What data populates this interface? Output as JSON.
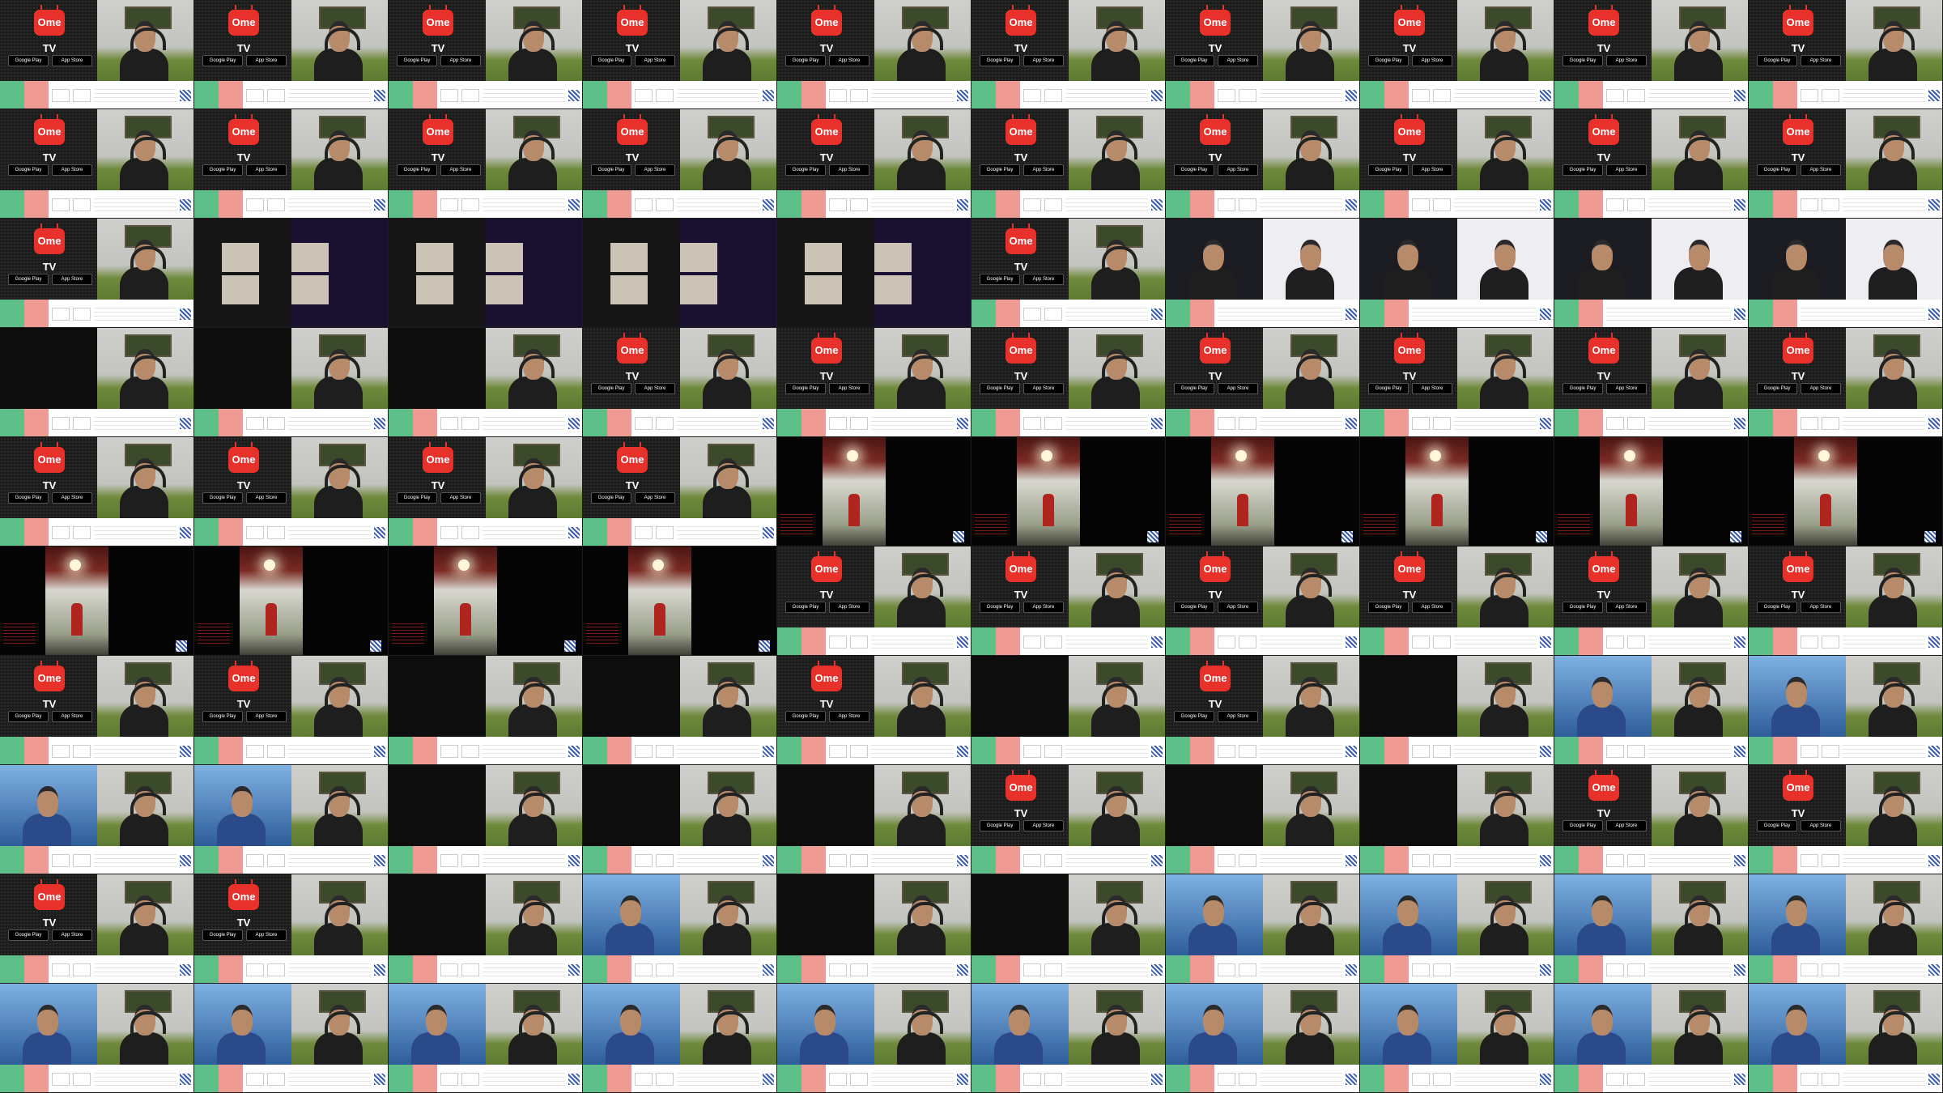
{
  "sheet": {
    "title": "",
    "cells": [
      {
        "layout": "ome"
      },
      {
        "layout": "ome"
      },
      {
        "layout": "ome"
      },
      {
        "layout": "ome"
      },
      {
        "layout": "ome"
      },
      {
        "layout": "ome"
      },
      {
        "layout": "ome"
      },
      {
        "layout": "ome"
      },
      {
        "layout": "ome"
      },
      {
        "layout": "ome"
      },
      {
        "layout": "ome"
      },
      {
        "layout": "ome"
      },
      {
        "layout": "ome"
      },
      {
        "layout": "ome"
      },
      {
        "layout": "ome"
      },
      {
        "layout": "ome"
      },
      {
        "layout": "ome"
      },
      {
        "layout": "ome"
      },
      {
        "layout": "ome"
      },
      {
        "layout": "ome"
      },
      {
        "layout": "ome"
      },
      {
        "layout": "purple"
      },
      {
        "layout": "purple"
      },
      {
        "layout": "purple"
      },
      {
        "layout": "purple"
      },
      {
        "layout": "ome"
      },
      {
        "layout": "stream"
      },
      {
        "layout": "stream"
      },
      {
        "layout": "stream"
      },
      {
        "layout": "stream"
      },
      {
        "layout": "dim"
      },
      {
        "layout": "dim"
      },
      {
        "layout": "dim"
      },
      {
        "layout": "ome"
      },
      {
        "layout": "ome"
      },
      {
        "layout": "ome"
      },
      {
        "layout": "ome"
      },
      {
        "layout": "ome"
      },
      {
        "layout": "ome"
      },
      {
        "layout": "ome"
      },
      {
        "layout": "ome"
      },
      {
        "layout": "ome"
      },
      {
        "layout": "ome"
      },
      {
        "layout": "ome"
      },
      {
        "layout": "dark"
      },
      {
        "layout": "dark"
      },
      {
        "layout": "dark"
      },
      {
        "layout": "dark"
      },
      {
        "layout": "dark"
      },
      {
        "layout": "dark"
      },
      {
        "layout": "dark"
      },
      {
        "layout": "dark"
      },
      {
        "layout": "dark"
      },
      {
        "layout": "dark"
      },
      {
        "layout": "ome"
      },
      {
        "layout": "ome"
      },
      {
        "layout": "ome"
      },
      {
        "layout": "ome"
      },
      {
        "layout": "ome"
      },
      {
        "layout": "ome"
      },
      {
        "layout": "ome"
      },
      {
        "layout": "ome"
      },
      {
        "layout": "dim"
      },
      {
        "layout": "dim"
      },
      {
        "layout": "ome"
      },
      {
        "layout": "dim"
      },
      {
        "layout": "ome"
      },
      {
        "layout": "dim"
      },
      {
        "layout": "guy"
      },
      {
        "layout": "guy"
      },
      {
        "layout": "guy"
      },
      {
        "layout": "guy"
      },
      {
        "layout": "dim"
      },
      {
        "layout": "dim"
      },
      {
        "layout": "dim"
      },
      {
        "layout": "ome"
      },
      {
        "layout": "dim"
      },
      {
        "layout": "dim"
      },
      {
        "layout": "ome"
      },
      {
        "layout": "ome"
      },
      {
        "layout": "ome"
      },
      {
        "layout": "ome"
      },
      {
        "layout": "dim"
      },
      {
        "layout": "guy"
      },
      {
        "layout": "dim"
      },
      {
        "layout": "dim"
      },
      {
        "layout": "guy"
      },
      {
        "layout": "guy"
      },
      {
        "layout": "guy"
      },
      {
        "layout": "guy"
      },
      {
        "layout": "guy"
      },
      {
        "layout": "guy"
      },
      {
        "layout": "guy"
      },
      {
        "layout": "guy"
      },
      {
        "layout": "guy"
      },
      {
        "layout": "guy"
      },
      {
        "layout": "guy"
      },
      {
        "layout": "guy"
      },
      {
        "layout": "guy"
      },
      {
        "layout": "guy"
      }
    ]
  },
  "ome_tile": {
    "logo_text": "Ome TV",
    "google_play": "Google Play",
    "app_store": "App Store"
  },
  "colors": {
    "start_green": "#5fbf8b",
    "stop_red": "#ef9b93",
    "logo_red": "#e8312a"
  },
  "icons": [
    "qr-code-icon",
    "omelogo-icon"
  ]
}
